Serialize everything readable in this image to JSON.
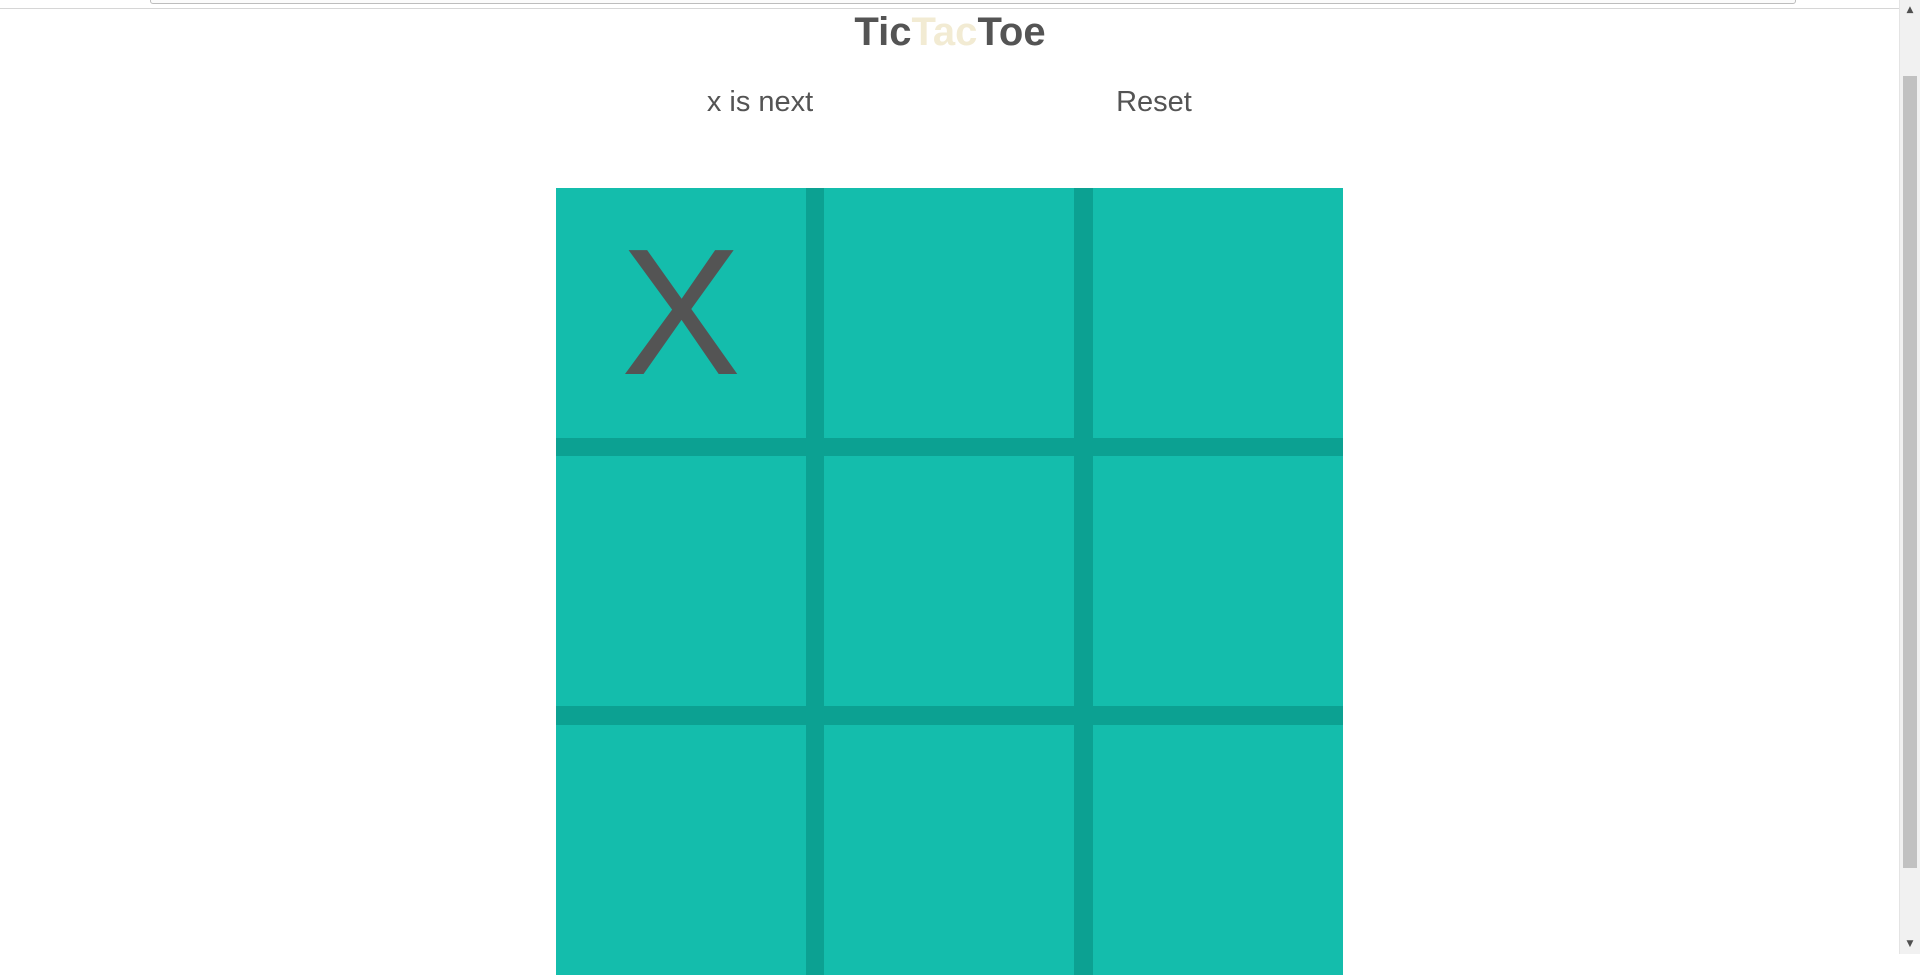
{
  "title": {
    "part1": "Tic",
    "part2": "Tac",
    "part3": "Toe"
  },
  "status": "x is next",
  "reset_label": "Reset",
  "colors": {
    "board_cell": "#14bdac",
    "board_lines": "#0ca192",
    "mark": "#545454",
    "title_accent": "#f2ebd3"
  },
  "board": {
    "cells": [
      "X",
      "",
      "",
      "",
      "",
      "",
      "",
      "",
      ""
    ]
  }
}
